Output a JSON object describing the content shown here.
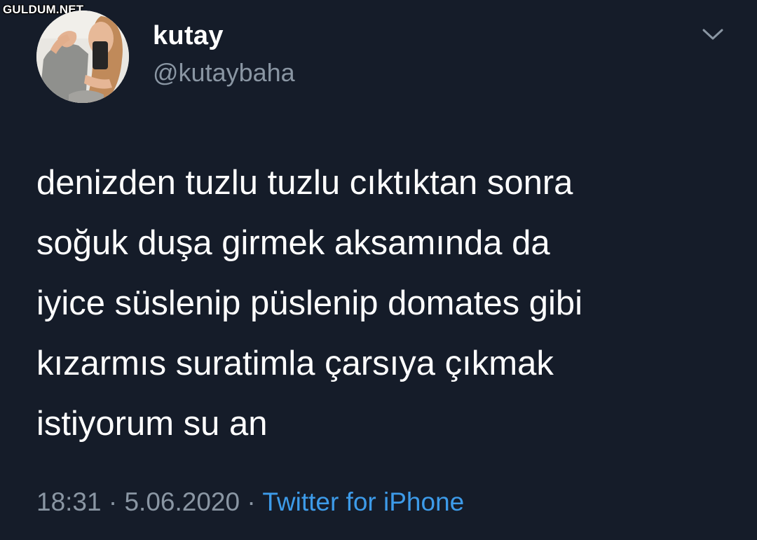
{
  "watermark": "GULDUM.NET",
  "user": {
    "display_name": "kutay",
    "handle": "@kutaybaha",
    "avatar_icon": "profile-photo"
  },
  "menu": {
    "icon": "chevron-down-icon"
  },
  "tweet": {
    "lines": [
      "denizden tuzlu tuzlu cıktıktan sonra",
      "soğuk duşa girmek aksamında da",
      "iyice süslenip püslenip domates gibi",
      "kızarmıs suratimla çarsıya çıkmak",
      "istiyorum su an"
    ]
  },
  "meta": {
    "time": "18:31",
    "separator": " · ",
    "date": "5.06.2020",
    "source": "Twitter for iPhone"
  },
  "colors": {
    "background": "#151c29",
    "text": "#ffffff",
    "muted": "#8a96a3",
    "link": "#3d9be9"
  }
}
